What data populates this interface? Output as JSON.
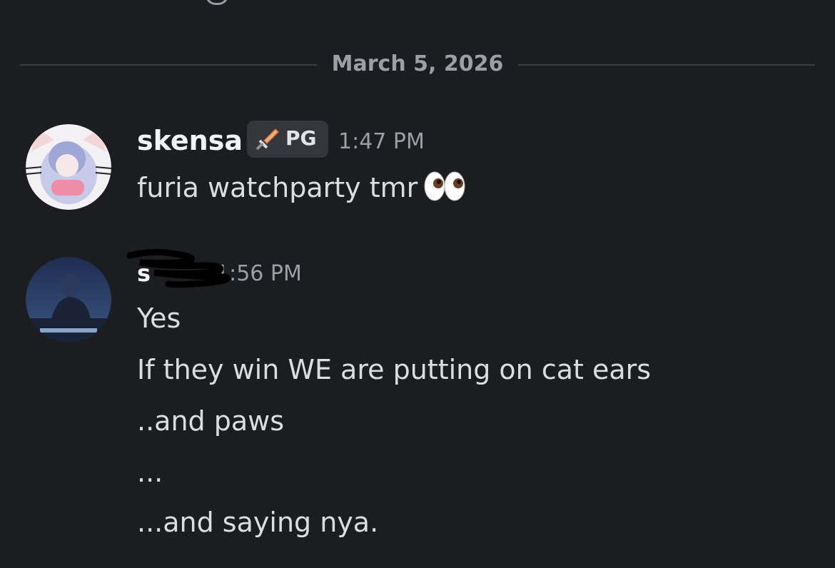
{
  "divider": {
    "date": "March 5, 2026"
  },
  "messages": [
    {
      "username": "skensa",
      "badge": "PG",
      "badge_icon": "sword-icon",
      "time": "1:47 PM",
      "lines": [
        "furia watchparty tmr"
      ],
      "emoji": "eyes-emoji"
    },
    {
      "username": "s",
      "time": "1:56 PM",
      "lines": [
        "Yes",
        "If they win WE are putting on cat ears",
        "..and paws",
        "...",
        "...and saying nya."
      ]
    }
  ],
  "colors": {
    "background": "#1c1d21",
    "username": "#f2f3f5",
    "text": "#dcdde1",
    "muted": "#9d9ea6",
    "badge_bg": "#35363c"
  }
}
